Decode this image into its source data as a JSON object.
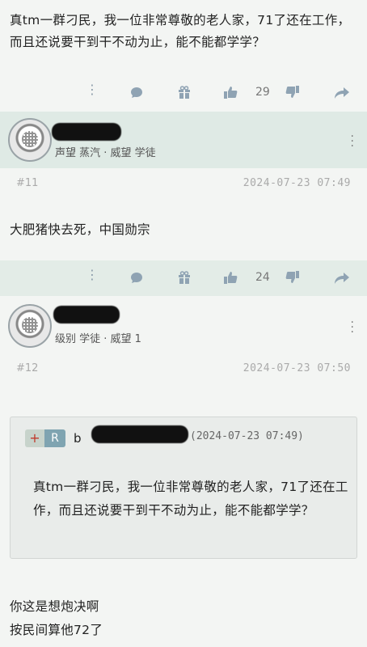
{
  "post1": {
    "body": "真tm一群刁民，我一位非常尊敬的老人家，71了还在工作，而且还说要干到干不动为止，能不能都学学？",
    "like_count": "29"
  },
  "user1": {
    "meta": "声望 蒸汽 · 威望 学徒"
  },
  "post2": {
    "floor": "#11",
    "date": "2024-07-23 07:49",
    "body": "大肥猪快去死，中国勋宗",
    "like_count": "24"
  },
  "user2": {
    "meta": "级别 学徒 · 威望 1"
  },
  "post3": {
    "floor": "#12",
    "date": "2024-07-23 07:50",
    "quote": {
      "plus": "+",
      "r": "R",
      "name_prefix": "b",
      "time": "(2024-07-23 07:49)",
      "text": "真tm一群刁民，我一位非常尊敬的老人家，71了还在工作，而且还说要干到干不动为止，能不能都学学？"
    },
    "reply_lines": [
      "你这是想炮决啊",
      "按民间算他72了"
    ]
  },
  "icons": {
    "more": "more-dots-icon",
    "comment": "comment-bubble-icon",
    "gift": "gift-icon",
    "like": "thumbs-up-icon",
    "dislike": "thumbs-down-icon",
    "share": "share-arrow-icon",
    "kebab": "kebab-menu-icon"
  }
}
